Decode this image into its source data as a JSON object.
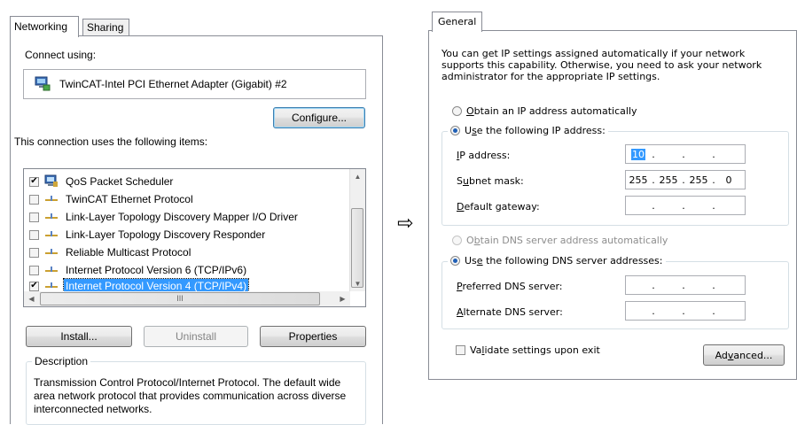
{
  "left_dialog": {
    "tabs": [
      {
        "label": "Networking",
        "active": true
      },
      {
        "label": "Sharing",
        "active": false
      }
    ],
    "connect_using_label": "Connect using:",
    "adapter_name": "TwinCAT-Intel PCI Ethernet Adapter (Gigabit) #2",
    "adapter_icon": "network-adapter-icon",
    "configure_button": "Configure...",
    "items_label": "This connection uses the following items:",
    "items": [
      {
        "label": "QoS Packet Scheduler",
        "checked": true,
        "icon": "qos-scheduler-icon",
        "selected": false
      },
      {
        "label": "TwinCAT Ethernet Protocol",
        "checked": false,
        "icon": "protocol-icon",
        "selected": false
      },
      {
        "label": "Link-Layer Topology Discovery Mapper I/O Driver",
        "checked": false,
        "icon": "protocol-icon",
        "selected": false
      },
      {
        "label": "Link-Layer Topology Discovery Responder",
        "checked": false,
        "icon": "protocol-icon",
        "selected": false
      },
      {
        "label": "Reliable Multicast Protocol",
        "checked": false,
        "icon": "protocol-icon",
        "selected": false
      },
      {
        "label": "Internet Protocol Version 6 (TCP/IPv6)",
        "checked": false,
        "icon": "protocol-icon",
        "selected": false
      },
      {
        "label": "Internet Protocol Version 4 (TCP/IPv4)",
        "checked": true,
        "icon": "protocol-icon",
        "selected": true
      }
    ],
    "hscroll_thumb_glyph": "III",
    "install_button": "Install...",
    "uninstall_button": "Uninstall",
    "properties_button": "Properties",
    "description_legend": "Description",
    "description_text": "Transmission Control Protocol/Internet Protocol. The default wide area network protocol that provides communication across diverse interconnected networks."
  },
  "arrow_glyph": "⇨",
  "right_dialog": {
    "tab_label": "General",
    "intro_text": "You can get IP settings assigned automatically if your network supports this capability. Otherwise, you need to ask your network administrator for the appropriate IP settings.",
    "obtain_ip_auto": {
      "pre": "",
      "key": "O",
      "post": "btain an IP address automatically",
      "checked": false
    },
    "use_following_ip": {
      "pre": "U",
      "key": "s",
      "post": "e the following IP address:",
      "checked": true
    },
    "ip_address": {
      "label_key": "I",
      "label_rest": "P address:",
      "octets": [
        "10",
        "",
        "",
        ""
      ]
    },
    "subnet_mask": {
      "label_pre": "S",
      "label_key": "u",
      "label_rest": "bnet mask:",
      "octets": [
        "255",
        "255",
        "255",
        "0"
      ]
    },
    "default_gateway": {
      "label_key": "D",
      "label_rest": "efault gateway:",
      "octets": [
        "",
        "",
        "",
        ""
      ]
    },
    "obtain_dns_auto": {
      "pre": "O",
      "key": "b",
      "post": "tain DNS server address automatically",
      "checked": false,
      "disabled": true
    },
    "use_following_dns": {
      "pre": "Us",
      "key": "e",
      "post": " the following DNS server addresses:",
      "checked": true
    },
    "preferred_dns": {
      "label_key": "P",
      "label_rest": "referred DNS server:",
      "octets": [
        "",
        "",
        "",
        ""
      ]
    },
    "alternate_dns": {
      "label_key": "A",
      "label_rest": "lternate DNS server:",
      "octets": [
        "",
        "",
        "",
        ""
      ]
    },
    "validate_settings": {
      "pre": "Va",
      "key": "l",
      "post": "idate settings upon exit",
      "checked": false
    },
    "advanced_button": {
      "pre": "Ad",
      "key": "v",
      "post": "anced..."
    }
  }
}
